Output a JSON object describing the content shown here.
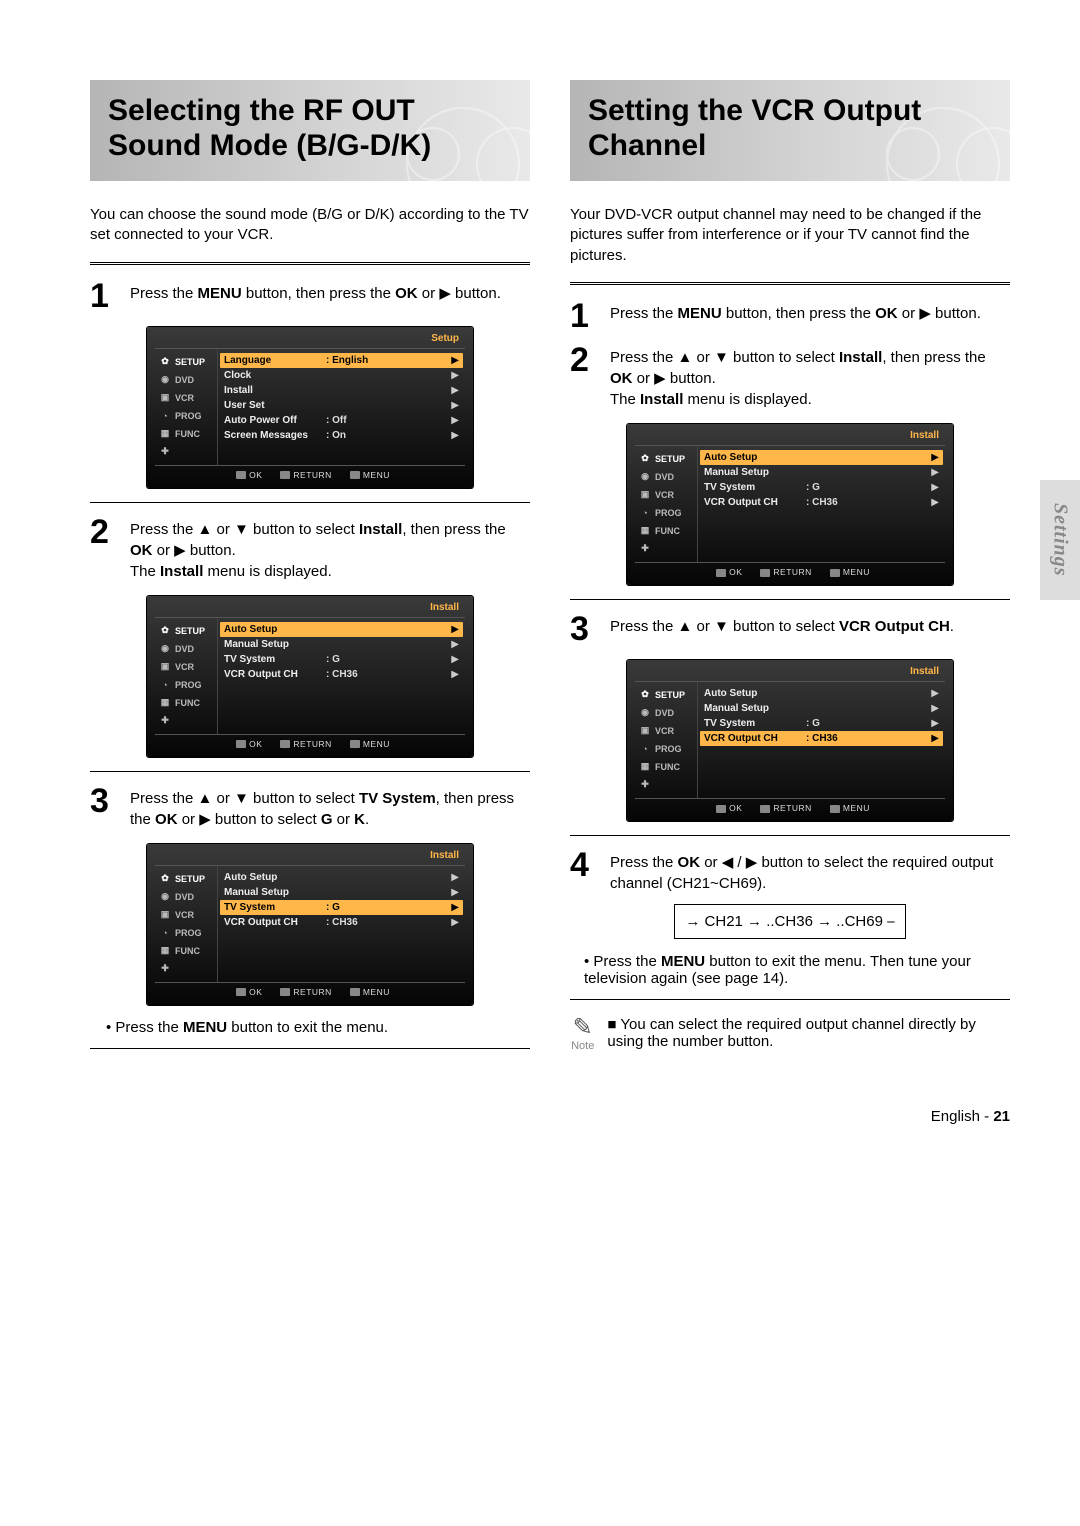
{
  "side_tab": "Settings",
  "left": {
    "title": "Selecting the RF OUT Sound Mode (B/G-D/K)",
    "intro": "You can choose the sound mode (B/G or D/K) according to the TV set connected to your VCR.",
    "step1": {
      "num": "1",
      "text_parts": [
        "Press the ",
        "MENU",
        " button, then press the ",
        "OK",
        " or ▶ button."
      ]
    },
    "step2": {
      "num": "2",
      "text_parts": [
        "Press the ▲ or ▼ button to select ",
        "Install",
        ", then press the ",
        "OK",
        " or ▶ button.\nThe ",
        "Install",
        " menu is displayed."
      ]
    },
    "step3": {
      "num": "3",
      "text_parts": [
        "Press the ▲ or ▼ button to select ",
        "TV System",
        ", then press the ",
        "OK",
        " or ▶ button to select ",
        "G",
        " or ",
        "K",
        "."
      ]
    },
    "exit_bullet": [
      "• Press the ",
      "MENU",
      " button to exit the menu."
    ]
  },
  "right": {
    "title": "Setting the VCR Output Channel",
    "intro": "Your DVD-VCR output channel may need to be changed if the pictures suffer from interference or if your TV cannot find the pictures.",
    "step1": {
      "num": "1",
      "text_parts": [
        "Press the ",
        "MENU",
        " button, then press the ",
        "OK",
        " or ▶ button."
      ]
    },
    "step2": {
      "num": "2",
      "text_parts": [
        "Press the ▲ or ▼ button to select ",
        "Install",
        ", then press the ",
        "OK",
        " or ▶ button.\nThe ",
        "Install",
        " menu is displayed."
      ]
    },
    "step3": {
      "num": "3",
      "text_parts": [
        "Press the ▲ or ▼ button to select ",
        "VCR Output CH",
        "."
      ]
    },
    "step4": {
      "num": "4",
      "text_parts": [
        "Press the ",
        "OK",
        " or ◀ / ▶ button to select the required output channel (CH21~CH69)."
      ]
    },
    "ch_sequence": "→ CH21 → ..CH36 → ..CH69 ⎯",
    "exit_bullet": [
      "• Press the ",
      "MENU",
      " button to exit the menu. Then tune your television again (see page 14)."
    ],
    "note": [
      "■ You can select the required output channel directly by using the number button."
    ],
    "note_label": "Note"
  },
  "osd_common": {
    "tabs": [
      "SETUP",
      "DVD",
      "VCR",
      "PROG",
      "FUNC"
    ],
    "footer": {
      "ok": "OK",
      "return": "RETURN",
      "menu": "MENU"
    }
  },
  "osd_setup": {
    "title": "Setup",
    "rows": [
      {
        "label": "Language",
        "val": ": English",
        "sel": true
      },
      {
        "label": "Clock",
        "val": "",
        "sel": false
      },
      {
        "label": "Install",
        "val": "",
        "sel": false
      },
      {
        "label": "User Set",
        "val": "",
        "sel": false
      },
      {
        "label": "Auto Power Off",
        "val": ": Off",
        "sel": false
      },
      {
        "label": "Screen Messages",
        "val": ": On",
        "sel": false
      }
    ]
  },
  "osd_install_auto": {
    "title": "Install",
    "rows": [
      {
        "label": "Auto Setup",
        "val": "",
        "sel": true
      },
      {
        "label": "Manual Setup",
        "val": "",
        "sel": false
      },
      {
        "label": "TV System",
        "val": ": G",
        "sel": false
      },
      {
        "label": "VCR Output CH",
        "val": ": CH36",
        "sel": false
      }
    ]
  },
  "osd_install_tv": {
    "title": "Install",
    "rows": [
      {
        "label": "Auto Setup",
        "val": "",
        "sel": false
      },
      {
        "label": "Manual Setup",
        "val": "",
        "sel": false
      },
      {
        "label": "TV System",
        "val": ": G",
        "sel": true
      },
      {
        "label": "VCR Output CH",
        "val": ": CH36",
        "sel": false
      }
    ]
  },
  "osd_install_vcr": {
    "title": "Install",
    "rows": [
      {
        "label": "Auto Setup",
        "val": "",
        "sel": false
      },
      {
        "label": "Manual Setup",
        "val": "",
        "sel": false
      },
      {
        "label": "TV System",
        "val": ": G",
        "sel": false
      },
      {
        "label": "VCR Output CH",
        "val": ": CH36",
        "sel": true
      }
    ]
  },
  "footer": {
    "lang": "English",
    "sep": " - ",
    "page": "21"
  }
}
